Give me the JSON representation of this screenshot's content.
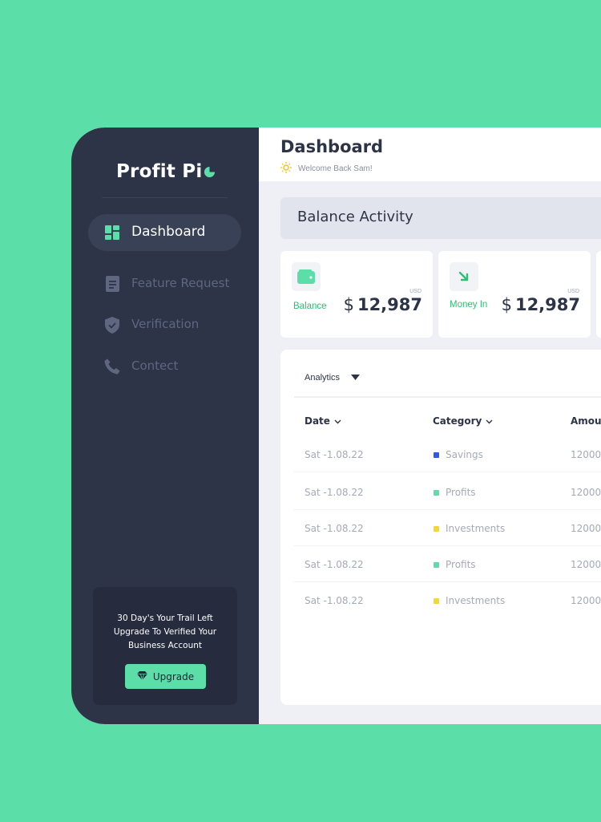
{
  "sidebar": {
    "logo_text": "Profit Pi",
    "logo_icon": "pie-chart-icon",
    "items": [
      {
        "label": "Dashboard",
        "icon": "dashboard-grid-icon",
        "active": true
      },
      {
        "label": "Feature Request",
        "icon": "document-icon",
        "active": false
      },
      {
        "label": "Verification",
        "icon": "shield-check-icon",
        "active": false
      },
      {
        "label": "Contect",
        "icon": "phone-icon",
        "active": false
      }
    ],
    "promo": {
      "line1": "30 Day's Your Trail Left",
      "line2": "Upgrade To Verified Your",
      "line3": "Business Account",
      "button_label": "Upgrade",
      "button_icon": "diamond-icon"
    }
  },
  "header": {
    "title": "Dashboard",
    "welcome": "Welcome Back Sam!",
    "welcome_icon": "sun-icon"
  },
  "section_title": "Balance Activity",
  "cards": [
    {
      "label": "Balance",
      "unit": "USD",
      "currency": "$",
      "amount": "12,987",
      "icon": "wallet-icon"
    },
    {
      "label": "Money In",
      "unit": "USD",
      "currency": "$",
      "amount": "12,987",
      "icon": "arrow-down-right-icon"
    }
  ],
  "table": {
    "filter_label": "Analytics",
    "columns": [
      "Date",
      "Category",
      "Amour"
    ],
    "rows": [
      {
        "date": "Sat -1.08.22",
        "category": "Savings",
        "color": "#2d5be3",
        "amount": "12000"
      },
      {
        "date": "Sat -1.08.22",
        "category": "Profits",
        "color": "#5cdea9",
        "amount": "12000"
      },
      {
        "date": "Sat -1.08.22",
        "category": "Investments",
        "color": "#f5d82e",
        "amount": "12000"
      },
      {
        "date": "Sat -1.08.22",
        "category": "Profits",
        "color": "#5cdea9",
        "amount": "12000"
      },
      {
        "date": "Sat -1.08.22",
        "category": "Investments",
        "color": "#f5d82e",
        "amount": "12000"
      }
    ]
  },
  "colors": {
    "accent": "#5cdea9",
    "sidebar": "#2d3448",
    "positive": "#2cc172"
  }
}
